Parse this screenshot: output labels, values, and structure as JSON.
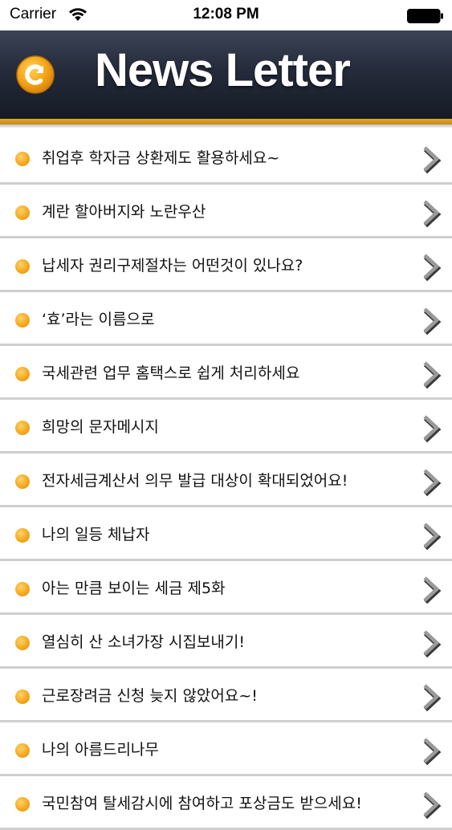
{
  "status_bar": {
    "carrier": "Carrier",
    "time": "12:08 PM"
  },
  "nav": {
    "title": "News Letter",
    "accent_color": "#f0a81c",
    "refresh_icon": "refresh-icon"
  },
  "newsletters": [
    {
      "title": "취업후 학자금 상환제도 활용하세요~"
    },
    {
      "title": "계란 할아버지와 노란우산"
    },
    {
      "title": "납세자 권리구제절차는 어떤것이 있나요?"
    },
    {
      "title": "‘효’라는 이름으로"
    },
    {
      "title": "국세관련 업무 홈택스로 쉽게 처리하세요"
    },
    {
      "title": "희망의 문자메시지"
    },
    {
      "title": "전자세금계산서 의무 발급 대상이 확대되었어요!"
    },
    {
      "title": "나의 일등 체납자"
    },
    {
      "title": "아는 만큼 보이는 세금 제5화"
    },
    {
      "title": "열심히 산 소녀가장 시집보내기!"
    },
    {
      "title": "근로장려금 신청 늦지 않았어요~!"
    },
    {
      "title": "나의 아름드리나무"
    },
    {
      "title": "국민참여 탈세감시에 참여하고 포상금도 받으세요!"
    }
  ]
}
